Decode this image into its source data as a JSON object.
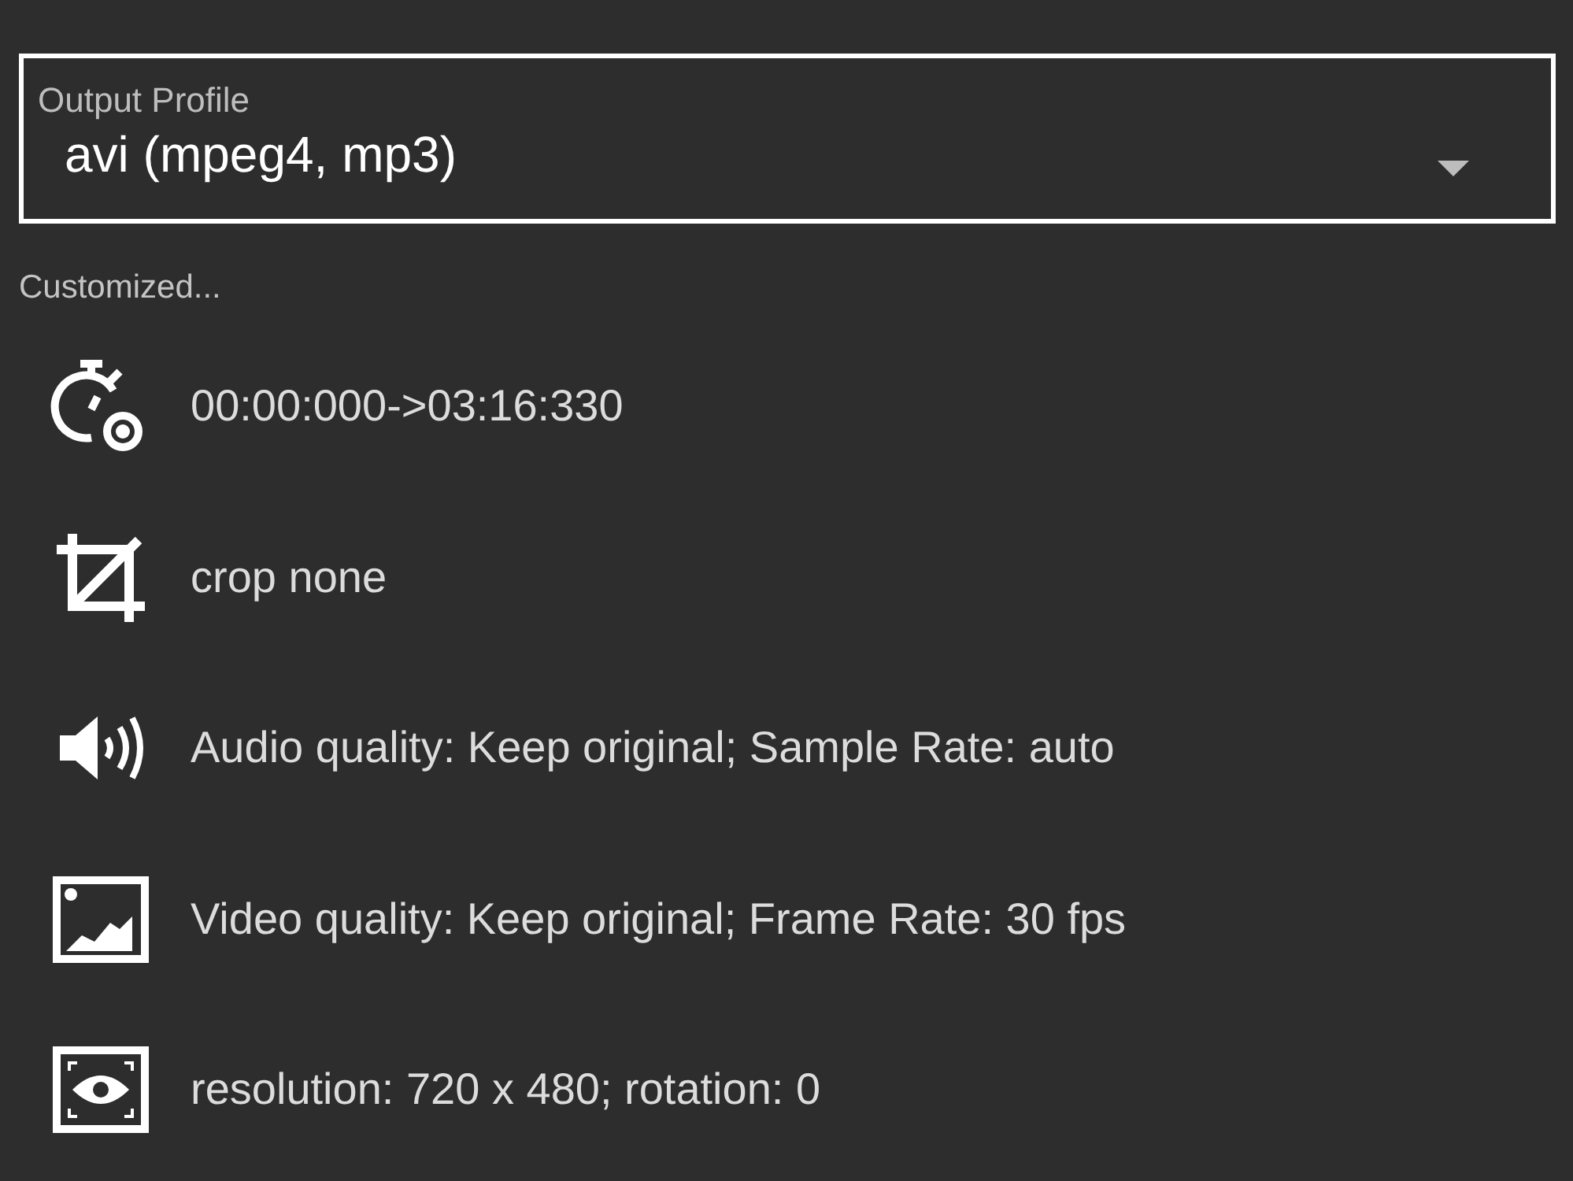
{
  "output_profile": {
    "label": "Output Profile",
    "value": "avi (mpeg4, mp3)"
  },
  "section_label": "Customized...",
  "settings": [
    {
      "kind": "time",
      "text": "00:00:000->03:16:330"
    },
    {
      "kind": "crop",
      "text": "crop none"
    },
    {
      "kind": "audio",
      "text": "Audio quality: Keep original; Sample Rate: auto"
    },
    {
      "kind": "video",
      "text": "Video quality: Keep original; Frame Rate: 30 fps"
    },
    {
      "kind": "resolution",
      "text": "resolution: 720 x 480; rotation: 0"
    }
  ]
}
